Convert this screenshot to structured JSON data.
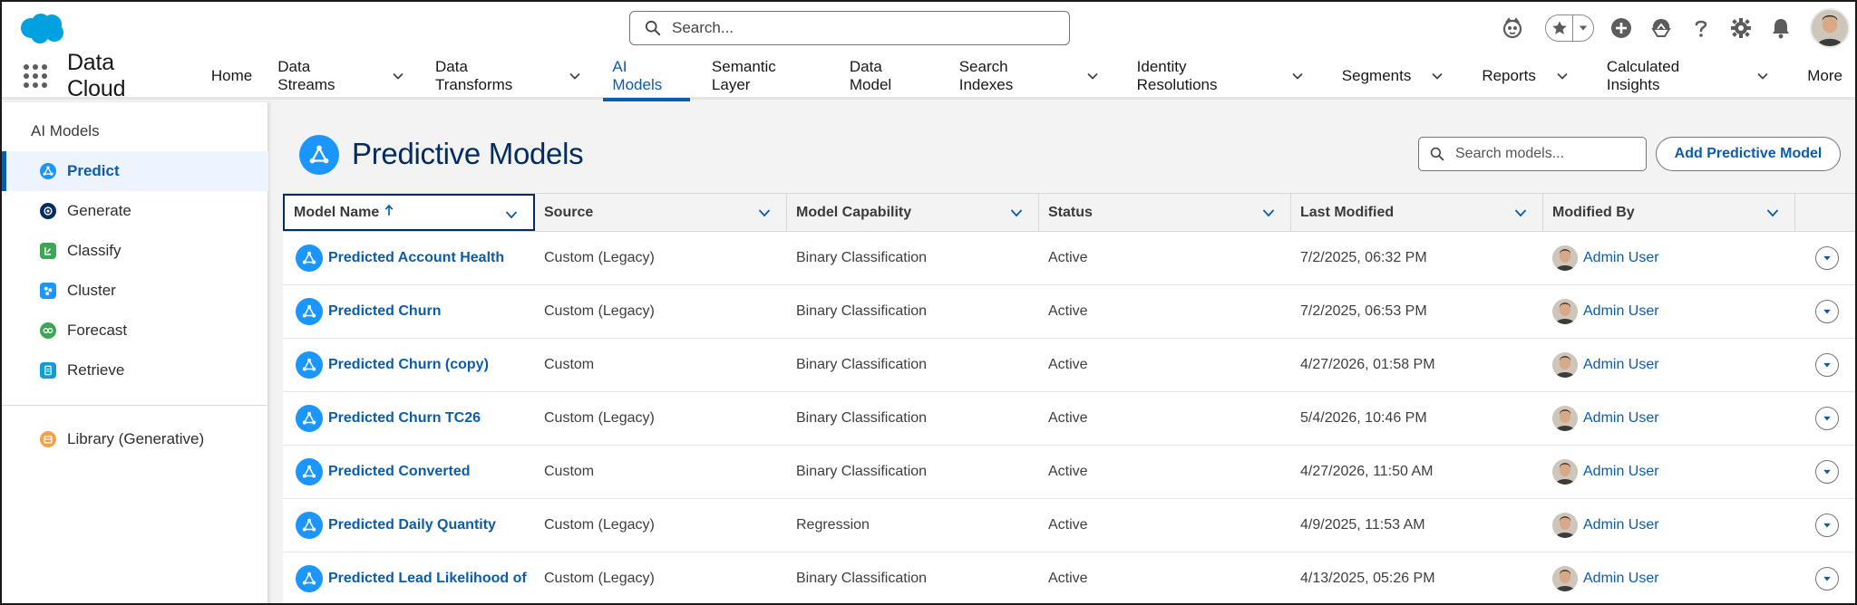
{
  "header": {
    "search_placeholder": "Search...",
    "icons": [
      "salesforce-logo",
      "einstein-icon",
      "favorites-star-icon",
      "favorites-dropdown-icon",
      "global-add-icon",
      "trailhead-icon",
      "help-icon",
      "setup-gear-icon",
      "notifications-bell-icon",
      "user-avatar"
    ]
  },
  "nav": {
    "app_name": "Data Cloud",
    "items": [
      {
        "label": "Home",
        "dropdown": false
      },
      {
        "label": "Data Streams",
        "dropdown": true
      },
      {
        "label": "Data Transforms",
        "dropdown": true
      },
      {
        "label": "AI Models",
        "dropdown": false,
        "active": true
      },
      {
        "label": "Semantic Layer",
        "dropdown": false
      },
      {
        "label": "Data Model",
        "dropdown": false
      },
      {
        "label": "Search Indexes",
        "dropdown": true
      },
      {
        "label": "Identity Resolutions",
        "dropdown": true
      },
      {
        "label": "Segments",
        "dropdown": true
      },
      {
        "label": "Reports",
        "dropdown": true
      },
      {
        "label": "Calculated Insights",
        "dropdown": true
      },
      {
        "label": "More",
        "dropdown": false
      }
    ]
  },
  "sidebar": {
    "title": "AI Models",
    "items": [
      {
        "label": "Predict",
        "active": true,
        "icon": "predict-icon",
        "color": "#1b96ff"
      },
      {
        "label": "Generate",
        "active": false,
        "icon": "generate-icon",
        "color": "#032d60"
      },
      {
        "label": "Classify",
        "active": false,
        "icon": "classify-icon",
        "color": "#3ba755"
      },
      {
        "label": "Cluster",
        "active": false,
        "icon": "cluster-icon",
        "color": "#1b96ff"
      },
      {
        "label": "Forecast",
        "active": false,
        "icon": "forecast-icon",
        "color": "#3ba755"
      },
      {
        "label": "Retrieve",
        "active": false,
        "icon": "retrieve-icon",
        "color": "#0d9dda"
      }
    ],
    "library": {
      "label": "Library (Generative)",
      "icon": "library-icon",
      "color": "#f4a24a"
    }
  },
  "main": {
    "title": "Predictive Models",
    "search_placeholder": "Search models...",
    "add_button": "Add Predictive Model",
    "columns": [
      {
        "label": "Model Name",
        "sorted": "asc"
      },
      {
        "label": "Source"
      },
      {
        "label": "Model Capability"
      },
      {
        "label": "Status"
      },
      {
        "label": "Last Modified"
      },
      {
        "label": "Modified By"
      }
    ],
    "rows": [
      {
        "name": "Predicted Account Health",
        "source": "Custom (Legacy)",
        "capability": "Binary Classification",
        "status": "Active",
        "modified": "7/2/2025, 06:32 PM",
        "user": "Admin User"
      },
      {
        "name": "Predicted Churn",
        "source": "Custom (Legacy)",
        "capability": "Binary Classification",
        "status": "Active",
        "modified": "7/2/2025, 06:53 PM",
        "user": "Admin User"
      },
      {
        "name": "Predicted Churn (copy)",
        "source": "Custom",
        "capability": "Binary Classification",
        "status": "Active",
        "modified": "4/27/2026, 01:58 PM",
        "user": "Admin User"
      },
      {
        "name": "Predicted Churn TC26",
        "source": "Custom (Legacy)",
        "capability": "Binary Classification",
        "status": "Active",
        "modified": "5/4/2026, 10:46 PM",
        "user": "Admin User"
      },
      {
        "name": "Predicted Converted",
        "source": "Custom",
        "capability": "Binary Classification",
        "status": "Active",
        "modified": "4/27/2026, 11:50 AM",
        "user": "Admin User"
      },
      {
        "name": "Predicted Daily Quantity",
        "source": "Custom (Legacy)",
        "capability": "Regression",
        "status": "Active",
        "modified": "4/9/2025, 11:53 AM",
        "user": "Admin User"
      },
      {
        "name": "Predicted Lead Likelihood of",
        "source": "Custom (Legacy)",
        "capability": "Binary Classification",
        "status": "Active",
        "modified": "4/13/2025, 05:26 PM",
        "user": "Admin User"
      }
    ]
  },
  "colors": {
    "brand_blue": "#0b5cab",
    "icon_blue": "#1b96ff",
    "title_navy": "#032d60"
  }
}
